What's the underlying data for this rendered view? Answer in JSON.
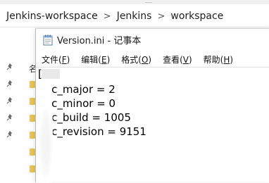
{
  "explorer": {
    "breadcrumb": [
      "Jenkins-workspace",
      "Jenkins",
      "workspace"
    ],
    "separator": ">",
    "tree_hint": "名"
  },
  "notepad": {
    "title": "Version.ini - 记事本",
    "menu": [
      {
        "label": "文件(",
        "accel": "F",
        "close": ")"
      },
      {
        "label": "编辑(",
        "accel": "E",
        "close": ")"
      },
      {
        "label": "格式(",
        "accel": "O",
        "close": ")"
      },
      {
        "label": "查看(",
        "accel": "V",
        "close": ")"
      },
      {
        "label": "帮助(",
        "accel": "H",
        "close": ")"
      }
    ],
    "lines": [
      "[   ]",
      "    c_major = 2",
      "    c_minor = 0",
      "    c_build = 1005",
      "    c_revision = 9151"
    ]
  },
  "colors": {
    "pin": "#6b6b6b",
    "folder": "#e8c25a"
  },
  "icons": {
    "pin": "pin-icon",
    "notepad": "notepad-icon"
  }
}
